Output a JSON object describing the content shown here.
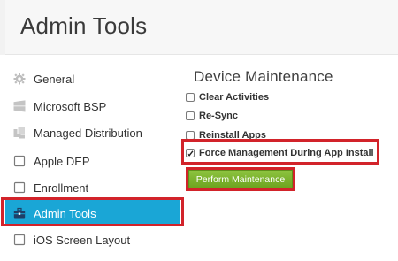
{
  "header": {
    "title": "Admin Tools"
  },
  "sidebar": {
    "items": [
      {
        "label": "General",
        "icon": "gear-icon"
      },
      {
        "label": "Microsoft BSP",
        "icon": "windows-icon"
      },
      {
        "label": "Managed Distribution",
        "icon": "managed-distribution-icon"
      },
      {
        "label": "Apple DEP",
        "icon": "square-icon"
      },
      {
        "label": "Enrollment",
        "icon": "square-icon"
      },
      {
        "label": "Admin Tools",
        "icon": "toolbox-icon",
        "active": true
      },
      {
        "label": "iOS Screen Layout",
        "icon": "square-icon"
      }
    ]
  },
  "main": {
    "section_title": "Device Maintenance",
    "options": [
      {
        "label": "Clear Activities",
        "checked": false
      },
      {
        "label": "Re-Sync",
        "checked": false
      },
      {
        "label": "Reinstall Apps",
        "checked": false
      },
      {
        "label": "Force Management During App Install",
        "checked": true
      }
    ],
    "perform_button": "Perform Maintenance"
  },
  "colors": {
    "active_nav": "#1aa6d6",
    "annotation_red": "#d2232a",
    "button_green": "#7cb532"
  }
}
